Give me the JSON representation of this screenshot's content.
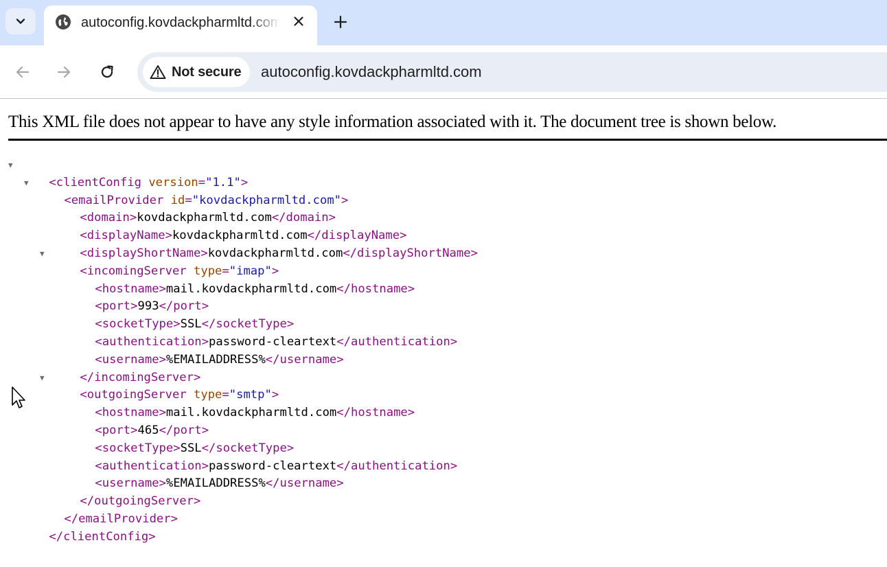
{
  "browser": {
    "tab_title": "autoconfig.kovdackpharmltd.com",
    "security_label": "Not secure",
    "url": "autoconfig.kovdackpharmltd.com"
  },
  "page": {
    "notice": "This XML file does not appear to have any style information associated with it. The document tree is shown below."
  },
  "xml": {
    "root_tag": "clientConfig",
    "root_attr_name": "version",
    "root_attr_value": "\"1.1\"",
    "provider_tag": "emailProvider",
    "provider_attr_name": "id",
    "provider_attr_value": "\"kovdackpharmltd.com\"",
    "domain_tag": "domain",
    "domain": "kovdackpharmltd.com",
    "display_name_tag": "displayName",
    "display_name": "kovdackpharmltd.com",
    "display_short_name_tag": "displayShortName",
    "display_short_name": "kovdackpharmltd.com",
    "incoming": {
      "tag": "incomingServer",
      "attr_name": "type",
      "attr_value": "\"imap\"",
      "hostname": "mail.kovdackpharmltd.com",
      "port": "993",
      "socket_type": "SSL",
      "authentication": "password-cleartext",
      "username": "%EMAILADDRESS%"
    },
    "outgoing": {
      "tag": "outgoingServer",
      "attr_name": "type",
      "attr_value": "\"smtp\"",
      "hostname": "mail.kovdackpharmltd.com",
      "port": "465",
      "socket_type": "SSL",
      "authentication": "password-cleartext",
      "username": "%EMAILADDRESS%"
    },
    "child_tags": {
      "hostname": "hostname",
      "port": "port",
      "socket_type": "socketType",
      "authentication": "authentication",
      "username": "username"
    }
  }
}
